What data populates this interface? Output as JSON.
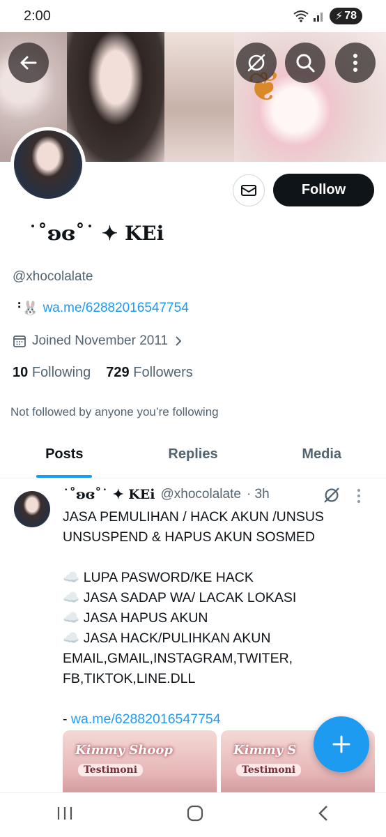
{
  "status_bar": {
    "time": "2:00",
    "battery": "78"
  },
  "banner": {
    "icons": [
      "back-arrow-icon",
      "grok-icon",
      "search-icon",
      "more-vertical-icon"
    ]
  },
  "profile": {
    "display_name": "˙˚ʚɞ˚˙ ✦ KEi",
    "handle": "@xhocolalate",
    "bio_prefix": "⠘🐰",
    "bio_link": "wa.me/62882016547754",
    "joined": "Joined November 2011",
    "following_count": "10",
    "following_label": "Following",
    "followers_count": "729",
    "followers_label": "Followers",
    "not_followed_text": "Not followed by anyone you’re following",
    "follow_label": "Follow"
  },
  "tabs": [
    {
      "label": "Posts",
      "active": true
    },
    {
      "label": "Replies",
      "active": false
    },
    {
      "label": "Media",
      "active": false
    }
  ],
  "post": {
    "author_name": "˙˚ʚɞ˚˙ ✦ KEi",
    "author_handle": "@xhocolalate",
    "time": "· 3h",
    "lines": [
      "JASA PEMULIHAN / HACK AKUN /UNSUS",
      "UNSUSPEND & HAPUS AKUN SOSMED",
      "",
      "☁️ LUPA PASWORD/KE HACK",
      "☁️ JASA SADAP WA/ LACAK LOKASI",
      "☁️ JASA HAPUS AKUN",
      "☁️ JASA HACK/PULIHKAN AKUN",
      "EMAIL,GMAIL,INSTAGRAM,TWITER,",
      "FB,TIKTOK,LINE.DLL",
      ""
    ],
    "link_prefix": "- ",
    "link": "wa.me/62882016547754",
    "media": [
      {
        "title": "Kimmy Shoop",
        "subtitle": "Testimoni"
      },
      {
        "title": "Kimmy S",
        "subtitle": "Testimoni"
      }
    ]
  }
}
